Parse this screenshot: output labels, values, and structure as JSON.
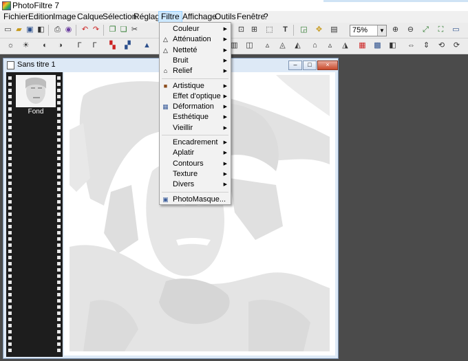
{
  "window": {
    "title": "PhotoFiltre 7"
  },
  "menubar": [
    {
      "label": "Fichier"
    },
    {
      "label": "Edition"
    },
    {
      "label": "Image"
    },
    {
      "label": "Calque"
    },
    {
      "label": "Sélection"
    },
    {
      "label": "Réglage"
    },
    {
      "label": "Filtre",
      "active": true
    },
    {
      "label": "Affichage"
    },
    {
      "label": "Outils"
    },
    {
      "label": "Fenêtre"
    },
    {
      "label": "?"
    }
  ],
  "toolbar": {
    "zoom_value": "75%"
  },
  "filter_menu": {
    "items": [
      {
        "label": "Couleur",
        "submenu": true,
        "icon": ""
      },
      {
        "label": "Atténuation",
        "submenu": true,
        "icon": "drop-icon"
      },
      {
        "label": "Netteté",
        "submenu": true,
        "icon": "triangle-icon"
      },
      {
        "label": "Bruit",
        "submenu": true,
        "icon": ""
      },
      {
        "label": "Relief",
        "submenu": true,
        "icon": "relief-icon"
      },
      {
        "label": "Artistique",
        "submenu": true,
        "icon": "painting-icon"
      },
      {
        "label": "Effet d'optique",
        "submenu": true,
        "icon": ""
      },
      {
        "label": "Déformation",
        "submenu": true,
        "icon": "grid-icon"
      },
      {
        "label": "Esthétique",
        "submenu": true,
        "icon": ""
      },
      {
        "label": "Vieillir",
        "submenu": true,
        "icon": ""
      },
      {
        "label": "Encadrement",
        "submenu": true,
        "icon": ""
      },
      {
        "label": "Aplatir",
        "submenu": true,
        "icon": ""
      },
      {
        "label": "Contours",
        "submenu": true,
        "icon": ""
      },
      {
        "label": "Texture",
        "submenu": true,
        "icon": ""
      },
      {
        "label": "Divers",
        "submenu": true,
        "icon": ""
      },
      {
        "label": "PhotoMasque...",
        "submenu": false,
        "icon": "photomask-icon"
      }
    ]
  },
  "document": {
    "title": "Sans titre 1",
    "layer_label": "Fond"
  },
  "colors": {
    "workspace": "#4b4b4b",
    "menu_highlight": "#cce8ff",
    "doc_frame": "#dde9f6",
    "filmstrip": "#1d1d1d"
  }
}
